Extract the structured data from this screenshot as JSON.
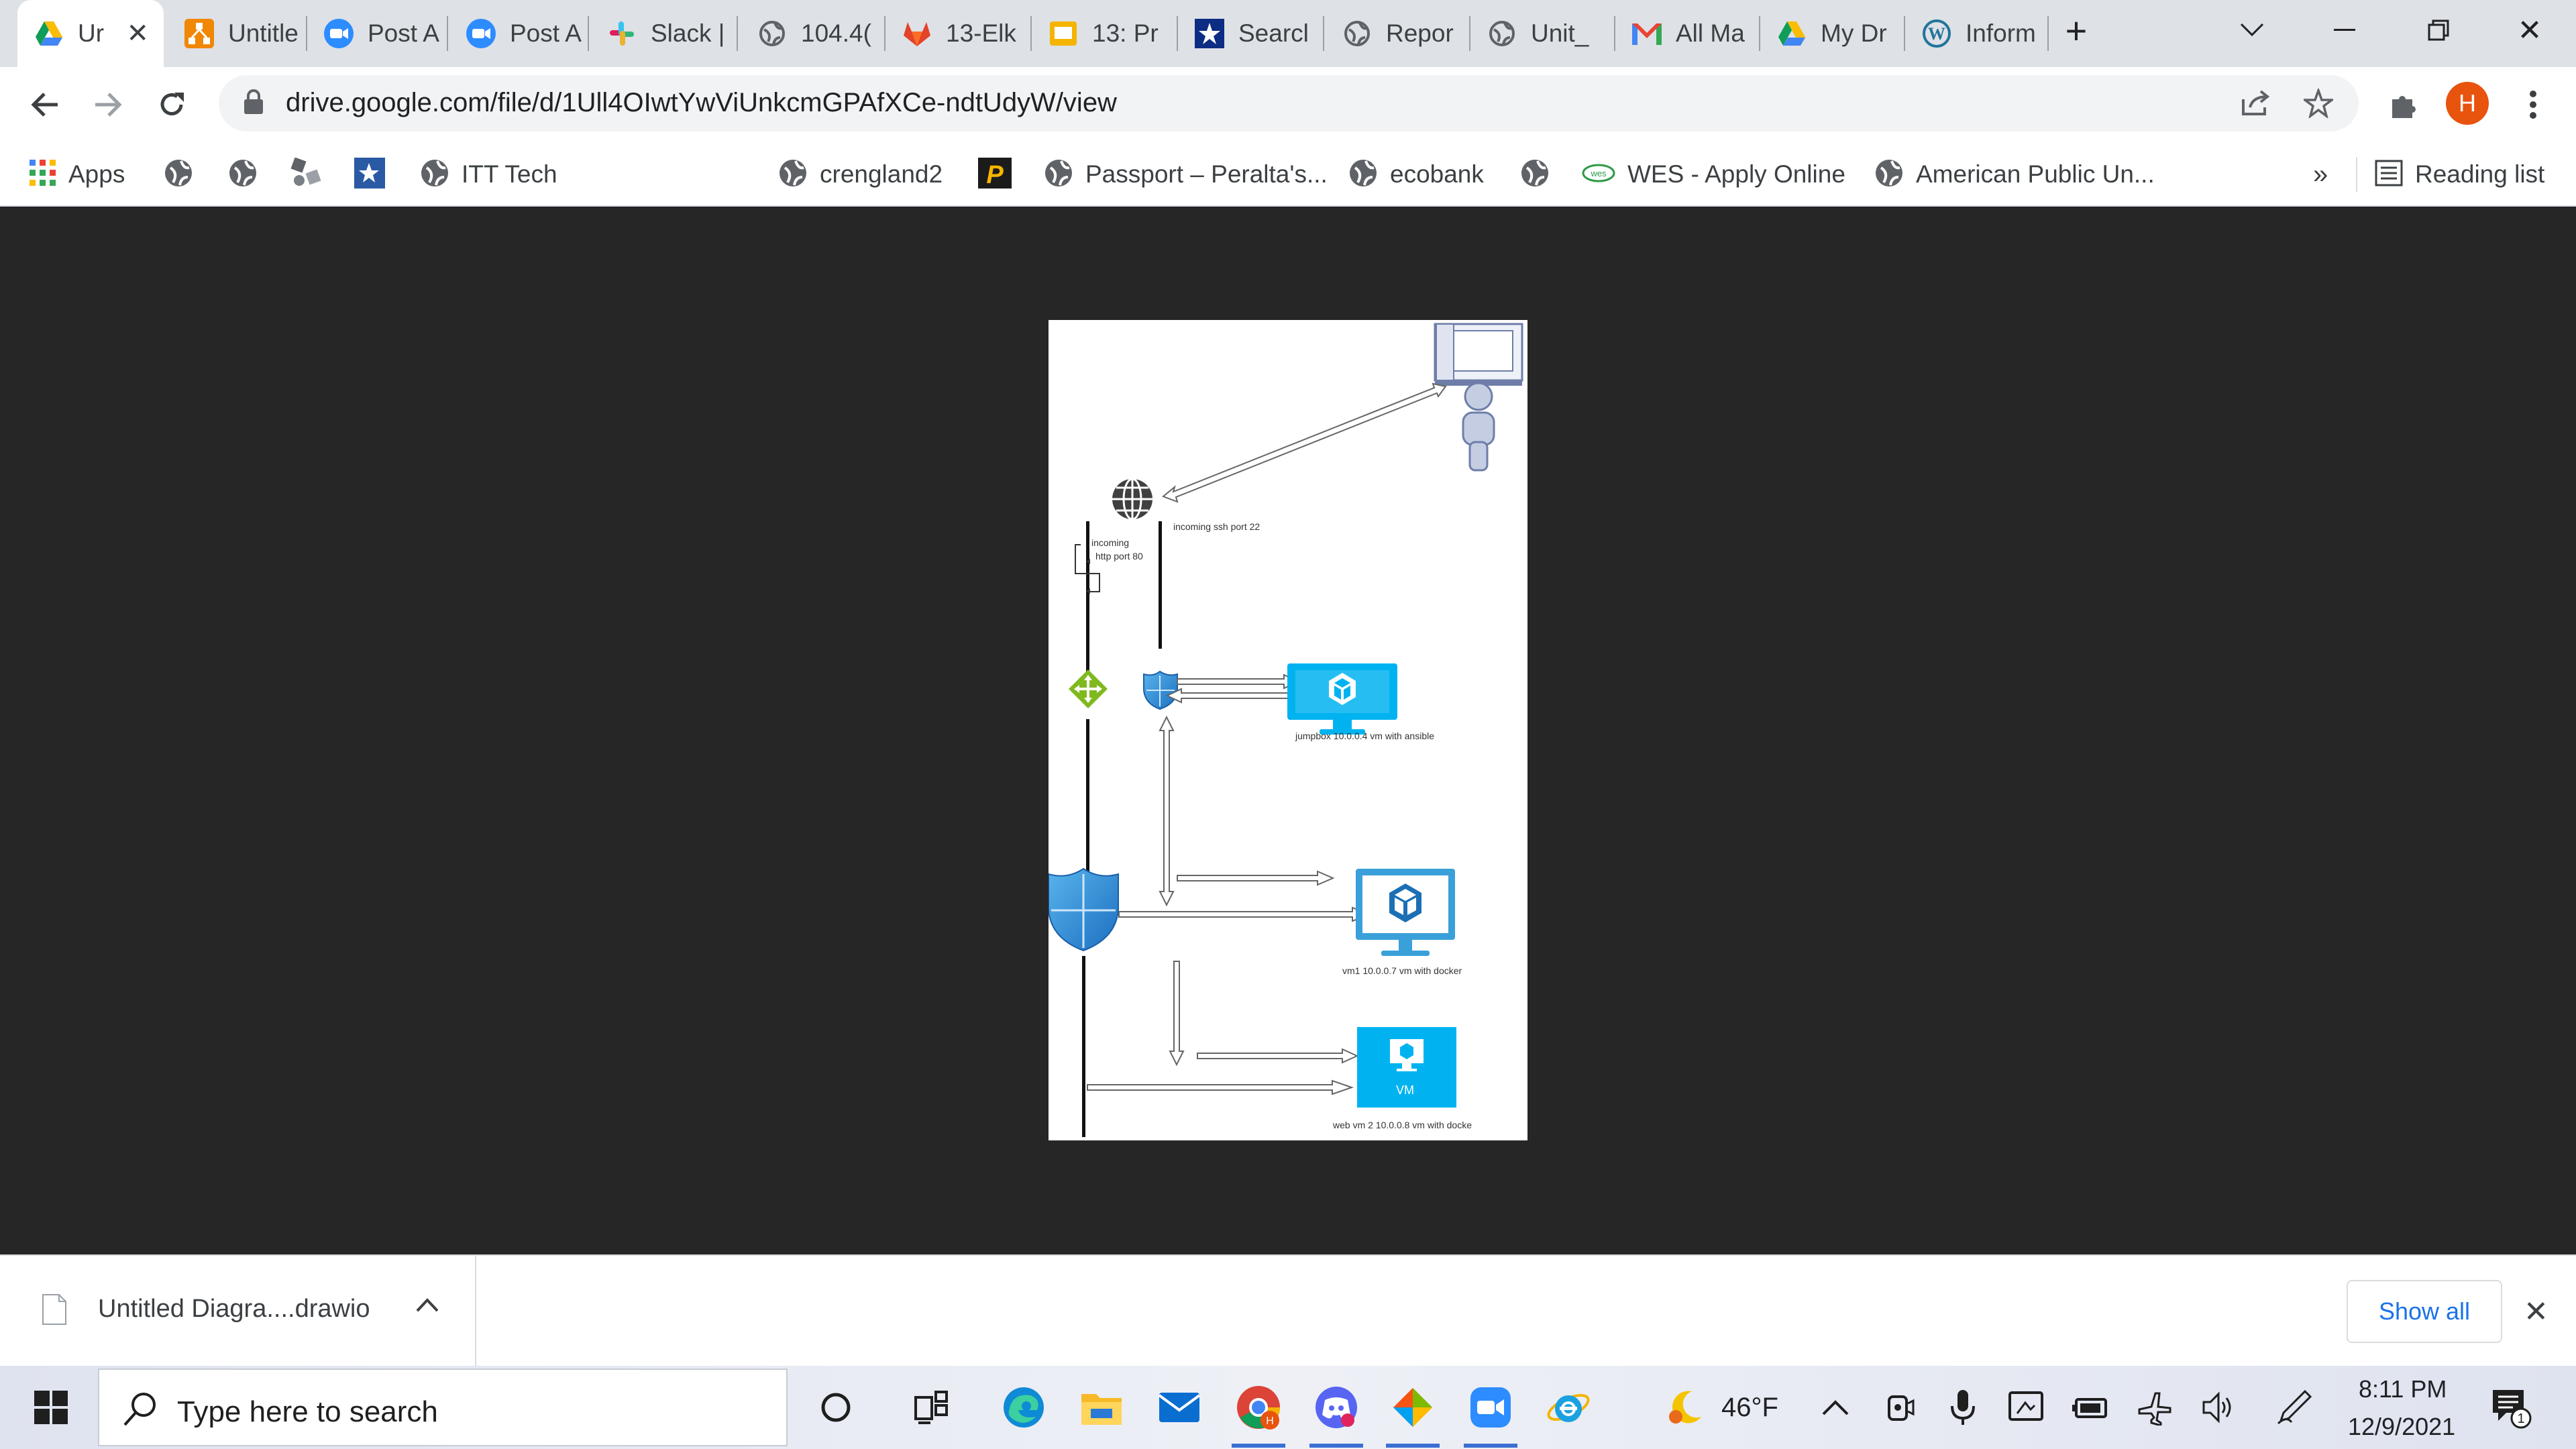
{
  "tabs": [
    {
      "label": "Ur",
      "icon": "google-drive-icon",
      "active": true
    },
    {
      "label": "Untitle",
      "icon": "drawio-icon"
    },
    {
      "label": "Post A",
      "icon": "zoom-icon"
    },
    {
      "label": "Post A",
      "icon": "zoom-icon"
    },
    {
      "label": "Slack |",
      "icon": "slack-icon"
    },
    {
      "label": "104.4(",
      "icon": "globe-icon"
    },
    {
      "label": "13-Elk",
      "icon": "gitlab-icon"
    },
    {
      "label": "13: Pr",
      "icon": "slides-icon"
    },
    {
      "label": "Searcl",
      "icon": "star-badge-icon"
    },
    {
      "label": "Repor",
      "icon": "globe-icon"
    },
    {
      "label": "Unit_",
      "icon": "globe-icon"
    },
    {
      "label": "All Ma",
      "icon": "gmail-icon"
    },
    {
      "label": "My Dr",
      "icon": "google-drive-icon"
    },
    {
      "label": "Inform",
      "icon": "wordpress-icon"
    }
  ],
  "toolbar": {
    "url": "drive.google.com/file/d/1Ull4OIwtYwViUnkcmGPAfXCe-ndtUdyW/view",
    "profile_initial": "H",
    "profile_color": "#e8530e"
  },
  "bookmarks": {
    "apps_label": "Apps",
    "items": [
      {
        "label": "ITT Tech"
      },
      {
        "label": "crengland2"
      },
      {
        "label": "Passport – Peralta's..."
      },
      {
        "label": "ecobank"
      },
      {
        "label": "WES - Apply Online"
      },
      {
        "label": "American Public Un..."
      }
    ],
    "overflow_label": "»",
    "reading_list_label": "Reading list"
  },
  "diagram": {
    "labels": {
      "ssh": "incoming ssh port 22",
      "http_line1": "incoming",
      "http_line2": "http port 80",
      "jumpbox": "jumpbox 10.0.0.4 vm with ansible",
      "vm1": "vm1 10.0.0.7 vm with docker",
      "vm2": "web vm 2 10.0.0.8 vm with docke",
      "vm_badge": "VM"
    }
  },
  "downloads": {
    "file_name": "Untitled Diagra....drawio",
    "show_all_label": "Show all"
  },
  "taskbar": {
    "search_placeholder": "Type here to search",
    "temperature": "46°F",
    "time": "8:11 PM",
    "date": "12/9/2021",
    "notification_count": "1"
  }
}
